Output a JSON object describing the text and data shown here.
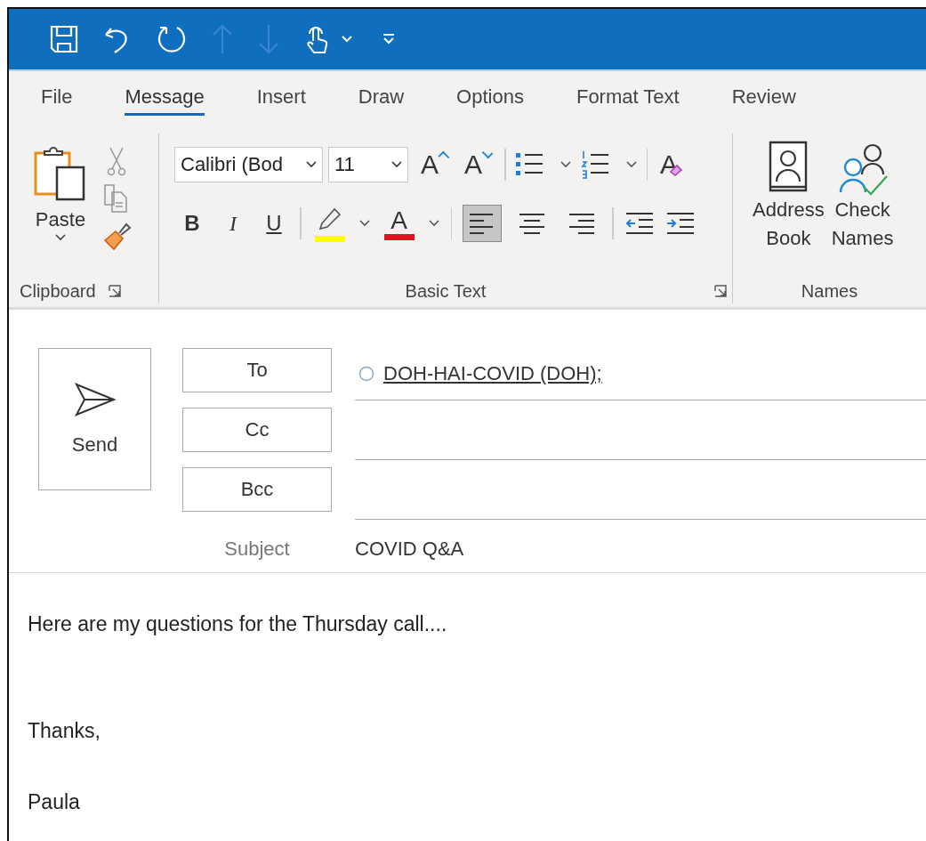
{
  "tabs": [
    {
      "label": "File",
      "selected": false
    },
    {
      "label": "Message",
      "selected": true
    },
    {
      "label": "Insert",
      "selected": false
    },
    {
      "label": "Draw",
      "selected": false
    },
    {
      "label": "Options",
      "selected": false
    },
    {
      "label": "Format Text",
      "selected": false
    },
    {
      "label": "Review",
      "selected": false
    }
  ],
  "ribbon": {
    "clipboard": {
      "label": "Clipboard",
      "paste_label": "Paste"
    },
    "basic_text": {
      "label": "Basic Text",
      "font": "Calibri (Bod",
      "size": "11",
      "font_size_tools": [
        {
          "kind": "grow",
          "glyph": "A"
        },
        {
          "kind": "shrink",
          "glyph": "A"
        }
      ],
      "clear_glyph": "A",
      "styles": [
        {
          "kind": "bold",
          "glyph": "B"
        },
        {
          "kind": "italic",
          "glyph": "I"
        },
        {
          "kind": "underline",
          "glyph": "U"
        }
      ],
      "color_tools": [
        {
          "kind": "highlight",
          "color": "#ffff00"
        },
        {
          "kind": "font_color",
          "glyph": "A",
          "color": "#e81123"
        }
      ],
      "alignments": [
        {
          "kind": "left",
          "selected": true
        },
        {
          "kind": "center",
          "selected": false
        },
        {
          "kind": "right",
          "selected": false
        }
      ]
    },
    "names": {
      "label": "Names",
      "buttons": [
        {
          "kind": "address_book",
          "lines": [
            "Address",
            "Book"
          ]
        },
        {
          "kind": "check_names",
          "lines": [
            "Check",
            "Names"
          ]
        }
      ]
    }
  },
  "compose": {
    "send_label": "Send",
    "recipients": [
      {
        "label": "To",
        "entries": [
          "DOH-HAI-COVID (DOH);"
        ]
      },
      {
        "label": "Cc"
      },
      {
        "label": "Bcc"
      }
    ],
    "subject_label": "Subject",
    "subject": "COVID Q&A"
  },
  "body": {
    "paragraphs": [
      "Here are my questions for the Thursday call....",
      "Thanks,",
      "Paula"
    ]
  }
}
